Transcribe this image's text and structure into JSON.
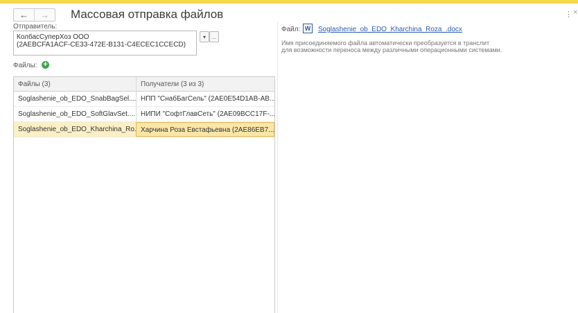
{
  "window": {
    "title": "Массовая отправка файлов"
  },
  "nav": {
    "back": "←",
    "forward": "→",
    "more": "⋮",
    "close": "×"
  },
  "sender": {
    "label": "Отправитель:",
    "line1": "КолбасСуперХоз ООО",
    "line2": "(2AEBCFA1ACF-CE33-472E-B131-C4ECEC1CCECD)",
    "dropdown": "▾",
    "select": "..."
  },
  "files": {
    "label": "Файлы:",
    "add": "+"
  },
  "table": {
    "headers": [
      "Файлы (3)",
      "Получатели (3 из 3)"
    ],
    "rows": [
      {
        "file": "Soglashenie_ob_EDO_SnabBagSel....",
        "recipient": "НПП \"СнабБагСель\" (2AE0E54D1AB-AB..."
      },
      {
        "file": "Soglashenie_ob_EDO_SoftGlavSet....",
        "recipient": "НИПИ \"СофтГлавСеть\" (2AE09BCC17F-..."
      },
      {
        "file": "Soglashenie_ob_EDO_Kharchina_Ro...",
        "recipient": "Харчина Роза Евстафьевна (2AE86EB7..."
      }
    ]
  },
  "details": {
    "file_label": "Файл:",
    "file_icon": "W",
    "file_name": "Soglashenie_ob_EDO_Kharchina_Roza_.docx",
    "note_line1": "Имя присоединяемого файла автоматически преобразуется в транслит",
    "note_line2": "для возможности переноса между различными операционными системами."
  },
  "colors": {
    "accent_bar": "#f6d64a",
    "selection": "#fbe6a8",
    "link": "#2a5db0",
    "add_icon": "#3aa54a"
  }
}
